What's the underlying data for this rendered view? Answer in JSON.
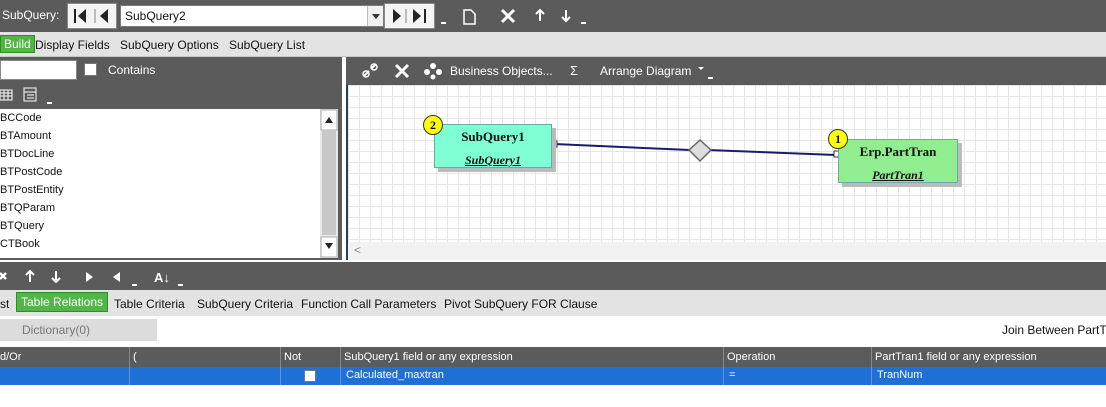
{
  "topbar": {
    "label": "SubQuery:",
    "subquery_value": "SubQuery2"
  },
  "menu": {
    "build_label": "Build",
    "items": [
      "Display Fields",
      "SubQuery Options",
      "SubQuery List"
    ]
  },
  "fields_panel": {
    "contains_label": "Contains",
    "items": [
      "BCCode",
      "BTAmount",
      "BTDocLine",
      "BTPostCode",
      "BTPostEntity",
      "BTQParam",
      "BTQuery",
      "CTBook"
    ]
  },
  "diagram_toolbar": {
    "business_objects_label": "Business Objects...",
    "sigma_label": "Σ",
    "arrange_label": "Arrange Diagram"
  },
  "diagram": {
    "scroll_left": "<",
    "tables": [
      {
        "badge": "2",
        "name": "SubQuery1",
        "alias": "SubQuery1",
        "color": "#7fffd4"
      },
      {
        "badge": "1",
        "name": "Erp.PartTran",
        "alias": "PartTran1",
        "color": "#90ee90"
      }
    ],
    "link_color": "#1a1a6e"
  },
  "tabs": {
    "items": [
      "st",
      "Table Relations",
      "Table Criteria",
      "SubQuery Criteria",
      "Function Call Parameters",
      "Pivot SubQuery FOR Clause"
    ],
    "active": "Table Relations"
  },
  "info": {
    "dictionary_label": "Dictionary(0)",
    "join_label": "Join Between PartT"
  },
  "grid": {
    "headers": [
      "d/Or",
      "(",
      "Not",
      "SubQuery1 field or any expression",
      "Operation",
      "PartTran1 field or any expression"
    ],
    "rows": [
      {
        "andor": "",
        "paren": "",
        "not": false,
        "left": "Calculated_maxtran",
        "op": "=",
        "right": "TranNum"
      }
    ],
    "selected_color": "#1e6fd6"
  }
}
